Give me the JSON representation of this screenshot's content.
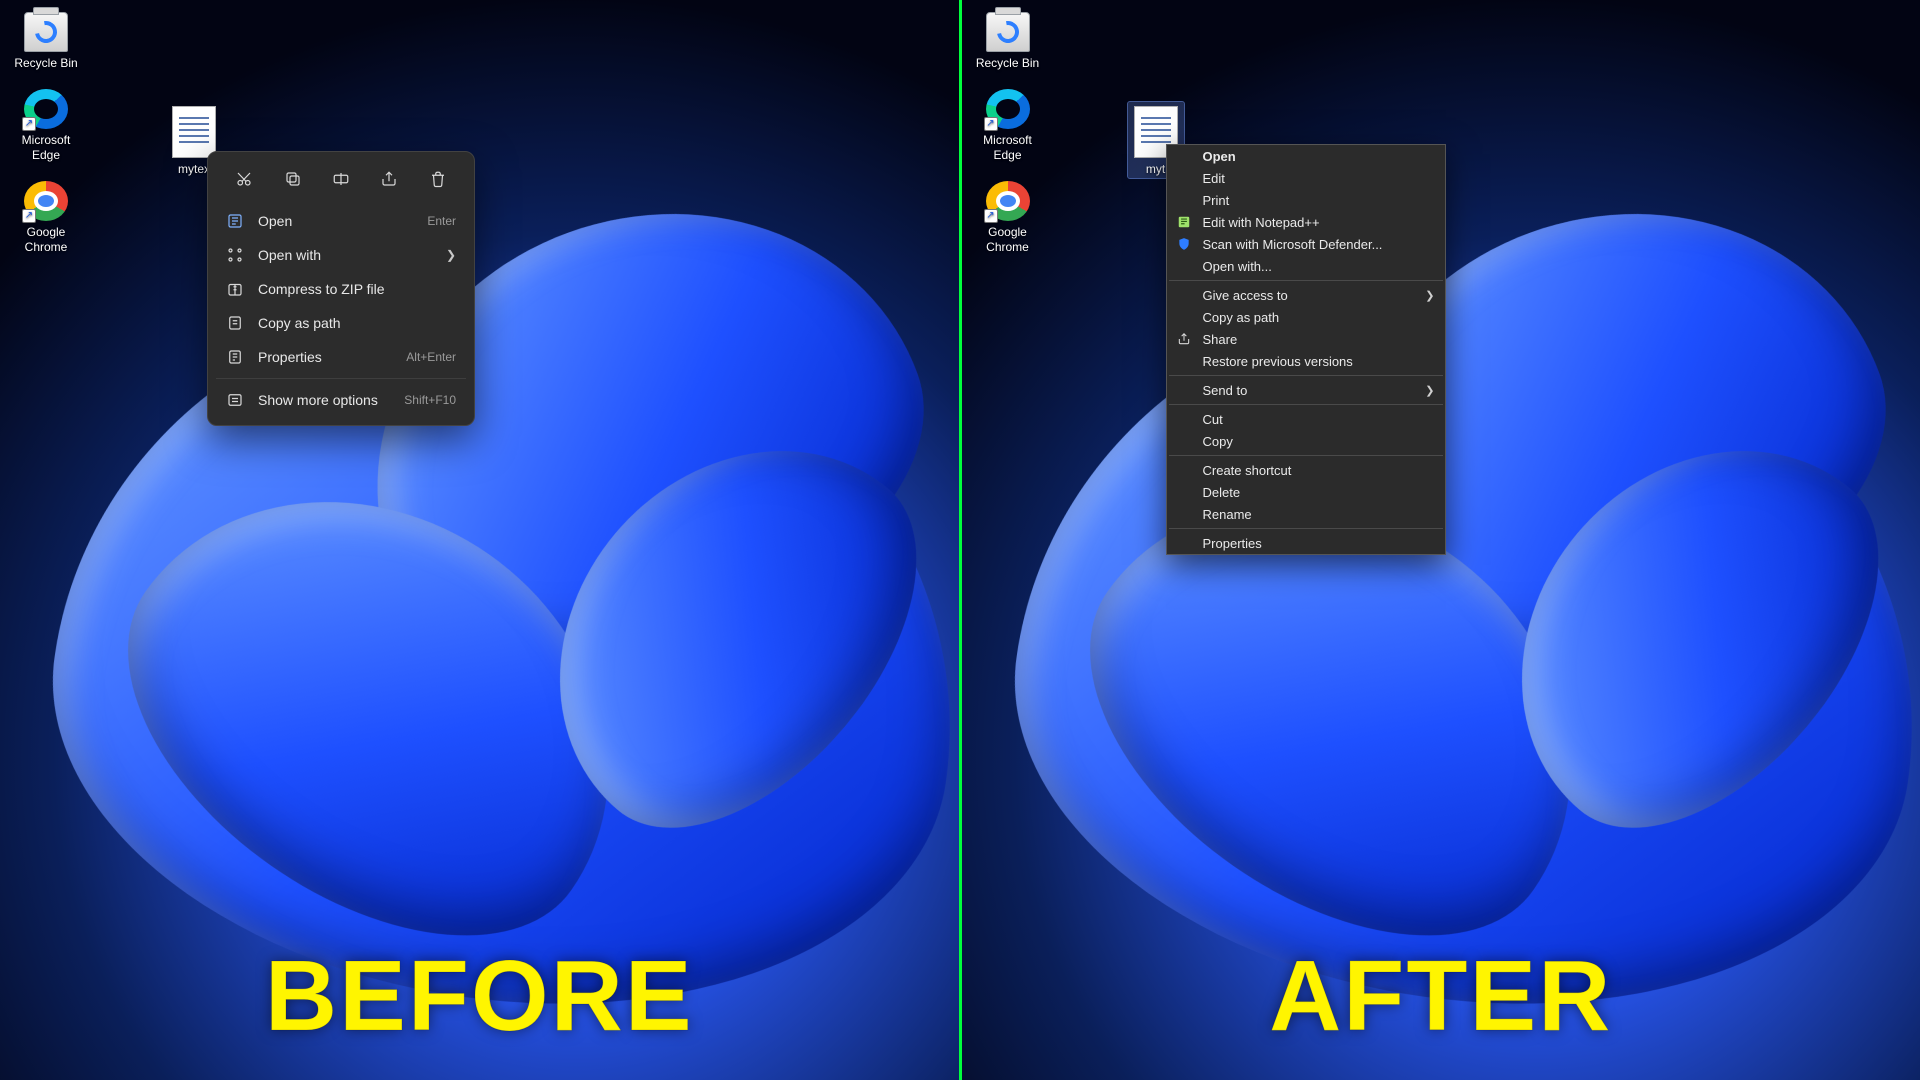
{
  "captions": {
    "before": "BEFORE",
    "after": "AFTER"
  },
  "left": {
    "icons": {
      "recycle": "Recycle Bin",
      "edge": "Microsoft Edge",
      "chrome": "Google Chrome"
    },
    "file_label": "mytex",
    "menu": {
      "open": "Open",
      "open_kbd": "Enter",
      "open_with": "Open with",
      "compress": "Compress to ZIP file",
      "copy_path": "Copy as path",
      "properties": "Properties",
      "properties_kbd": "Alt+Enter",
      "show_more": "Show more options",
      "show_more_kbd": "Shift+F10"
    }
  },
  "right": {
    "icons": {
      "recycle": "Recycle Bin",
      "edge": "Microsoft Edge",
      "chrome": "Google Chrome"
    },
    "file_label": "myt",
    "menu": {
      "open": "Open",
      "edit": "Edit",
      "print": "Print",
      "npp": "Edit with Notepad++",
      "defender": "Scan with Microsoft Defender...",
      "open_with": "Open with...",
      "give_access": "Give access to",
      "copy_path": "Copy as path",
      "share": "Share",
      "restore": "Restore previous versions",
      "send_to": "Send to",
      "cut": "Cut",
      "copy": "Copy",
      "shortcut": "Create shortcut",
      "delete": "Delete",
      "rename": "Rename",
      "properties": "Properties"
    }
  }
}
